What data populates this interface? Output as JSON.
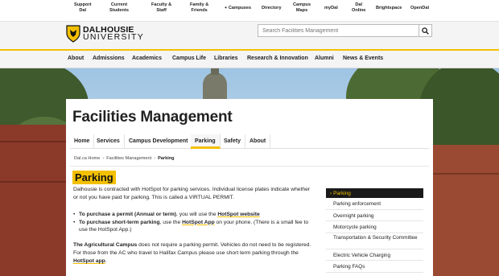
{
  "top_links": [
    {
      "label": "Support\nDal"
    },
    {
      "label": "Current\nStudents"
    },
    {
      "label": "Faculty &\nStaff"
    },
    {
      "label": "Family &\nFriends"
    },
    {
      "label": "+ Campuses"
    },
    {
      "label": "Directory"
    },
    {
      "label": "Campus\nMaps"
    },
    {
      "label": "myDal"
    },
    {
      "label": "Dal\nOnline"
    },
    {
      "label": "Brightspace"
    },
    {
      "label": "OpenDal"
    }
  ],
  "logo": {
    "line1": "DALHOUSIE",
    "line2": "UNIVERSITY"
  },
  "search": {
    "placeholder": "Search Facilities Management"
  },
  "main_nav": [
    "About",
    "Admissions",
    "Academics",
    "Campus Life",
    "Libraries",
    "Research & Innovation",
    "Alumni",
    "News & Events"
  ],
  "site_title": "Facilities Management",
  "sub_nav": [
    "Home",
    "Services",
    "Campus Development",
    "Parking",
    "Safety",
    "About"
  ],
  "breadcrumb": {
    "home": "Dal.ca Home",
    "section": "Facilities Management",
    "current": "Parking"
  },
  "page_title": "Parking",
  "intro": "Dalhousie is contracted with HotSpot for parking services. Individual license plates indicate whether or not you have paid for parking. This is called a VIRTUAL PERMIT.",
  "bullets": [
    {
      "lead": "To purchase a permit (Annual or term)",
      "mid": ", you will use the ",
      "link": "HotSpot website",
      "tail": ""
    },
    {
      "lead": "To purchase short-term parking",
      "mid": ", use the ",
      "link": "HotSpot App",
      "tail": " on your phone. (There is a small fee to use the HotSpot App.)"
    }
  ],
  "agri": {
    "lead": "The Agricultural Campus",
    "body": " does not require a parking permit. Vehicles do not need to be registered. For those from the AC who travel to Halifax Campus please use short term parking through the ",
    "link": "HotSpot app",
    "end": "."
  },
  "side_menu": [
    "Parking",
    "Parking enforcement",
    "Overnight parking",
    "Motorcycle parking",
    "Transportation & Security Committee",
    "Electric Vehicle Charging",
    "Parking FAQs"
  ],
  "colors": {
    "accent": "#f3c000",
    "dark": "#1a1a1a"
  }
}
